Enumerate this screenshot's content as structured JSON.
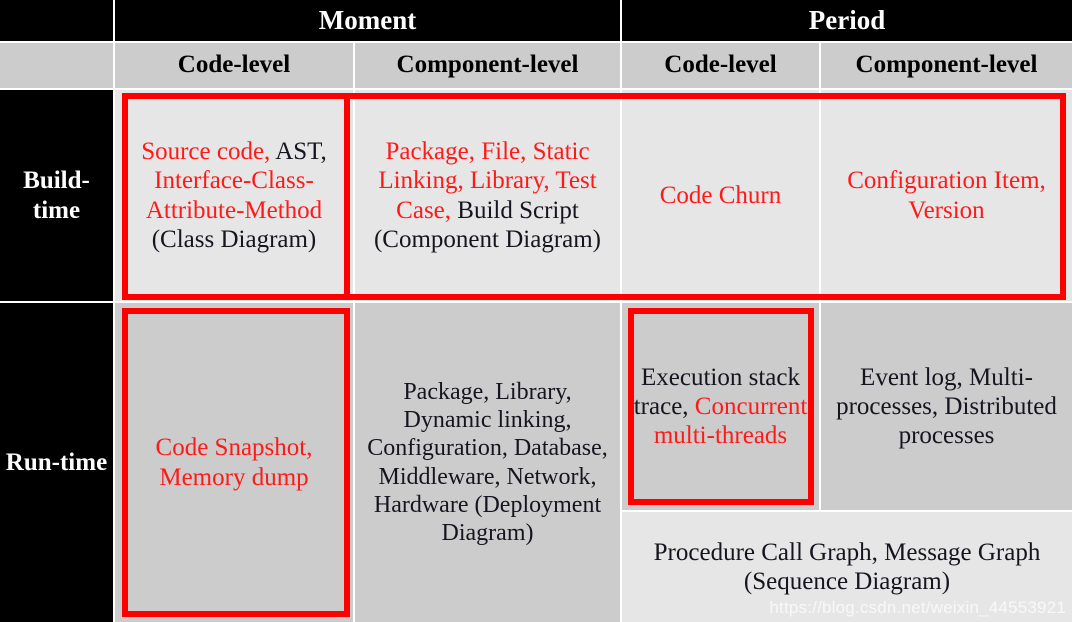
{
  "table": {
    "corner_label": "",
    "top_headers": [
      {
        "label": "Moment",
        "span": 2
      },
      {
        "label": "Period",
        "span": 2
      }
    ],
    "sub_headers": [
      "Code-level",
      "Component-level",
      "Code-level",
      "Component-level"
    ],
    "row_labels": [
      "Build-time",
      "Run-time"
    ],
    "cells": {
      "build_moment_code": {
        "runs": [
          {
            "text": "Source code,",
            "color": "red"
          },
          {
            "text": "AST,",
            "color": "black"
          },
          {
            "text": "Interface-Class-Attribute-Method",
            "color": "red"
          },
          {
            "text": "(Class Diagram)",
            "color": "black"
          }
        ],
        "plain": "Source code, AST, Interface-Class-Attribute-Method (Class Diagram)"
      },
      "build_moment_component": {
        "runs": [
          {
            "text": "Package, File, Static Linking, Library, Test Case,",
            "color": "red"
          },
          {
            "text": "Build Script (Component Diagram)",
            "color": "black"
          }
        ],
        "plain": "Package, File, Static Linking, Library, Test Case, Build Script (Component Diagram)"
      },
      "build_period_code": {
        "runs": [
          {
            "text": "Code Churn",
            "color": "red"
          }
        ],
        "plain": "Code Churn"
      },
      "build_period_component": {
        "runs": [
          {
            "text": "Configuration Item, Version",
            "color": "red"
          }
        ],
        "plain": "Configuration Item, Version"
      },
      "run_moment_code": {
        "runs": [
          {
            "text": "Code Snapshot, Memory dump",
            "color": "red"
          }
        ],
        "plain": "Code Snapshot, Memory dump"
      },
      "run_moment_component": {
        "runs": [
          {
            "text": "Package, Library, Dynamic  linking, Configuration, Database, Middleware, Network, Hardware (Deployment Diagram)",
            "color": "black"
          }
        ],
        "plain": "Package, Library, Dynamic  linking, Configuration, Database, Middleware, Network, Hardware (Deployment Diagram)"
      },
      "run_period_code": {
        "runs": [
          {
            "text": "Execution stack trace,",
            "color": "black"
          },
          {
            "text": "Concurrent multi-threads",
            "color": "red"
          }
        ],
        "plain": "Execution stack trace, Concurrent multi-threads"
      },
      "run_period_component": {
        "runs": [
          {
            "text": "Event log, Multi-processes, Distributed processes",
            "color": "black"
          }
        ],
        "plain": "Event log, Multi-processes, Distributed processes"
      },
      "run_period_merged": {
        "runs": [
          {
            "text": "Procedure Call Graph, Message Graph (Sequence Diagram)",
            "color": "black"
          }
        ],
        "plain": "Procedure Call Graph, Message Graph (Sequence Diagram)"
      }
    },
    "highlight_color": "#ff0000",
    "header_bg": "#000000",
    "subheader_bg": "#cccccc",
    "buildtime_bg": "#e6e6e6",
    "runtime_bg": "#cccccc"
  },
  "watermark": {
    "text": "https://blog.csdn.net/weixin_44553921"
  }
}
